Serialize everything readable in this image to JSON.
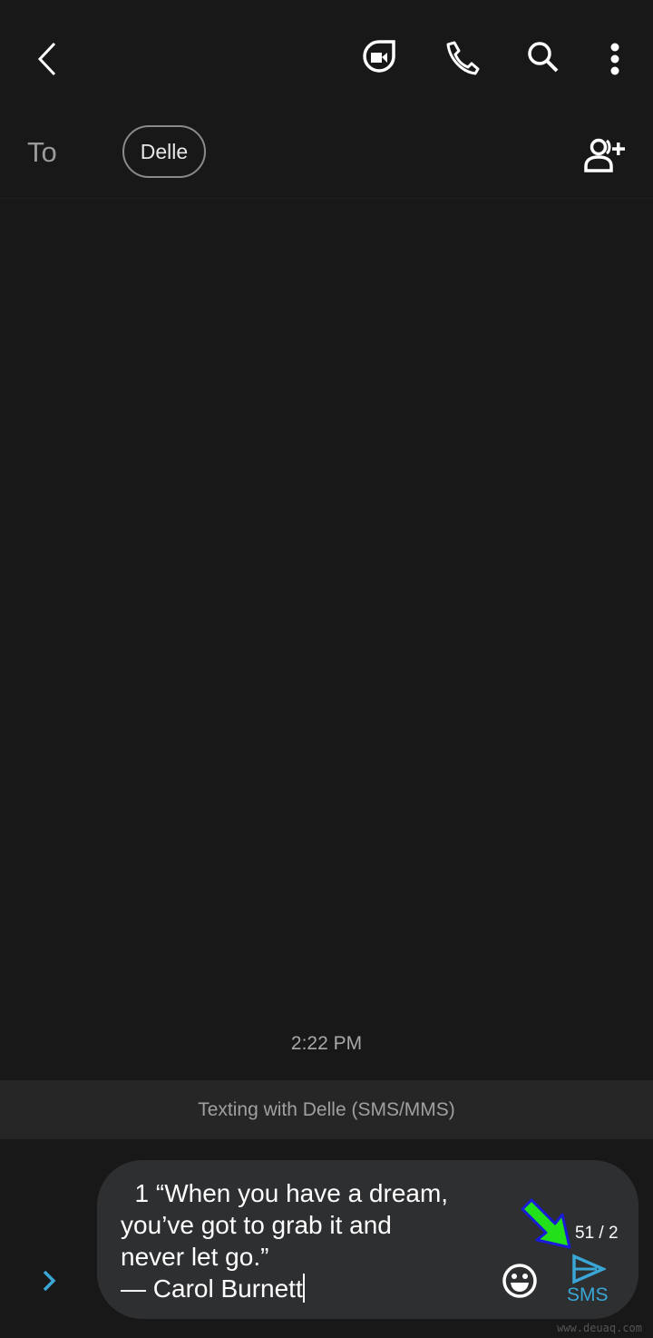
{
  "header": {
    "icons": [
      "back-chevron-icon",
      "video-call-icon",
      "phone-icon",
      "search-icon",
      "more-vert-icon"
    ]
  },
  "recipients": {
    "to_label": "To",
    "chips": [
      "Delle"
    ],
    "add_icon": "add-contact-icon"
  },
  "conversation": {
    "timestamp": "2:22 PM",
    "banner": "Texting with Delle (SMS/MMS)"
  },
  "composer": {
    "text": "  1 “When you have a dream,\nyou’ve got to grab it and\nnever let go.”\n— Carol Burnett",
    "counter": "51 / 2",
    "send_label": "SMS",
    "accent_color": "#3aa6d6",
    "expand_icon": "chevron-right-icon",
    "emoji_icon": "emoji-icon",
    "send_icon": "send-icon"
  },
  "annotation": {
    "arrow_color": "#22e01a",
    "arrow_outline": "#1a1ad8"
  },
  "watermark": "www.deuaq.com"
}
